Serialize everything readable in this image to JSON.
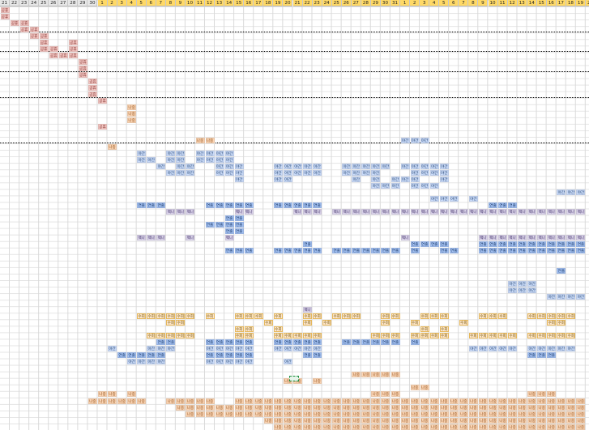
{
  "sheet": {
    "header_days": [
      {
        "label": "21",
        "style": "gray"
      },
      {
        "label": "22",
        "style": "gray"
      },
      {
        "label": "23",
        "style": "gray"
      },
      {
        "label": "24",
        "style": "gray"
      },
      {
        "label": "25",
        "style": "gray"
      },
      {
        "label": "26",
        "style": "gray"
      },
      {
        "label": "27",
        "style": "gray"
      },
      {
        "label": "28",
        "style": "gray"
      },
      {
        "label": "29",
        "style": "gray"
      },
      {
        "label": "30",
        "style": "gray"
      },
      {
        "label": "1",
        "style": "yellow"
      },
      {
        "label": "2",
        "style": "yellow"
      },
      {
        "label": "3",
        "style": "yellow"
      },
      {
        "label": "4",
        "style": "yellow"
      },
      {
        "label": "5",
        "style": "yellow"
      },
      {
        "label": "6",
        "style": "yellow"
      },
      {
        "label": "7",
        "style": "yellow"
      },
      {
        "label": "8",
        "style": "yellow"
      },
      {
        "label": "9",
        "style": "yellow"
      },
      {
        "label": "10",
        "style": "yellow"
      },
      {
        "label": "11",
        "style": "yellow"
      },
      {
        "label": "12",
        "style": "yellow"
      },
      {
        "label": "13",
        "style": "yellow"
      },
      {
        "label": "14",
        "style": "yellow"
      },
      {
        "label": "15",
        "style": "yellow"
      },
      {
        "label": "16",
        "style": "yellow"
      },
      {
        "label": "17",
        "style": "yellow"
      },
      {
        "label": "18",
        "style": "yellow"
      },
      {
        "label": "19",
        "style": "yellow"
      },
      {
        "label": "20",
        "style": "yellow"
      },
      {
        "label": "21",
        "style": "yellow"
      },
      {
        "label": "22",
        "style": "yellow"
      },
      {
        "label": "23",
        "style": "yellow"
      },
      {
        "label": "24",
        "style": "yellow"
      },
      {
        "label": "25",
        "style": "yellow"
      },
      {
        "label": "26",
        "style": "yellow"
      },
      {
        "label": "27",
        "style": "yellow"
      },
      {
        "label": "28",
        "style": "yellow"
      },
      {
        "label": "29",
        "style": "yellow"
      },
      {
        "label": "30",
        "style": "yellow"
      },
      {
        "label": "31",
        "style": "yellow"
      },
      {
        "label": "1",
        "style": "yellow"
      },
      {
        "label": "2",
        "style": "yellow"
      },
      {
        "label": "3",
        "style": "yellow"
      },
      {
        "label": "4",
        "style": "yellow"
      },
      {
        "label": "5",
        "style": "yellow"
      },
      {
        "label": "6",
        "style": "yellow"
      },
      {
        "label": "7",
        "style": "yellow"
      },
      {
        "label": "8",
        "style": "yellow"
      },
      {
        "label": "9",
        "style": "yellow"
      },
      {
        "label": "10",
        "style": "yellow"
      },
      {
        "label": "11",
        "style": "yellow"
      },
      {
        "label": "12",
        "style": "yellow"
      },
      {
        "label": "13",
        "style": "yellow"
      },
      {
        "label": "14",
        "style": "yellow"
      },
      {
        "label": "15",
        "style": "yellow"
      },
      {
        "label": "16",
        "style": "yellow"
      },
      {
        "label": "17",
        "style": "yellow"
      },
      {
        "label": "18",
        "style": "yellow"
      },
      {
        "label": "19",
        "style": "yellow"
      },
      {
        "label": "20",
        "style": "yellow"
      }
    ],
    "section_dividers": [
      4,
      7,
      10,
      14,
      21
    ],
    "colors": {
      "header_gray": "#e7e7e7",
      "header_yellow": "#ffd966",
      "pink": "#f4c7c3",
      "orange": "#fbd5b5",
      "blue": "#c9daf8",
      "blue_dark": "#a4c2f4",
      "lavender": "#d9d2e9",
      "gold": "#fce5cd",
      "selection": "#1e8e3e"
    },
    "labels": {
      "pink": "공휴",
      "orange": "나중",
      "blue": "야간",
      "blue_dark": "연출",
      "lavender": "팩나",
      "gold": "수회"
    },
    "runs": [
      {
        "row": 1,
        "cols": [
          0
        ],
        "color": "pink"
      },
      {
        "row": 2,
        "cols": [
          0
        ],
        "color": "pink"
      },
      {
        "row": 3,
        "cols": [
          1,
          2
        ],
        "color": "pink"
      },
      {
        "row": 4,
        "cols": [
          2,
          3
        ],
        "color": "pink"
      },
      {
        "row": 5,
        "cols": [
          3,
          4
        ],
        "color": "pink"
      },
      {
        "row": 6,
        "cols": [
          4,
          7
        ],
        "color": "pink"
      },
      {
        "row": 7,
        "cols": [
          4,
          5,
          7
        ],
        "color": "pink"
      },
      {
        "row": 8,
        "cols": [
          5,
          6,
          7
        ],
        "color": "pink"
      },
      {
        "row": 9,
        "cols": [
          8
        ],
        "color": "pink"
      },
      {
        "row": 10,
        "cols": [
          8
        ],
        "color": "pink"
      },
      {
        "row": 11,
        "cols": [
          8
        ],
        "color": "pink"
      },
      {
        "row": 12,
        "cols": [
          9
        ],
        "color": "pink"
      },
      {
        "row": 13,
        "cols": [
          9
        ],
        "color": "pink"
      },
      {
        "row": 14,
        "cols": [
          9
        ],
        "color": "pink"
      },
      {
        "row": 15,
        "cols": [
          10
        ],
        "color": "pink"
      },
      {
        "row": 16,
        "cols": [
          13
        ],
        "color": "orange"
      },
      {
        "row": 17,
        "cols": [
          13
        ],
        "color": "orange"
      },
      {
        "row": 18,
        "cols": [
          13
        ],
        "color": "orange"
      },
      {
        "row": 19,
        "cols": [
          10
        ],
        "color": "pink"
      },
      {
        "row": 21,
        "cols": [
          20,
          21
        ],
        "color": "orange"
      },
      {
        "row": 21,
        "cols": [
          41,
          42,
          43
        ],
        "color": "blue"
      },
      {
        "row": 22,
        "cols": [
          11
        ],
        "color": "orange"
      },
      {
        "row": 23,
        "cols": [
          14,
          17,
          18,
          20,
          21,
          22,
          23
        ],
        "color": "blue"
      },
      {
        "row": 24,
        "cols": [
          14,
          15,
          17,
          18,
          20,
          21,
          22,
          23
        ],
        "color": "blue"
      },
      {
        "row": 25,
        "cols": [
          16,
          18,
          19,
          22,
          23,
          24,
          28,
          29,
          30,
          31,
          32,
          35,
          36,
          37,
          38,
          39,
          41,
          42,
          43,
          44,
          45
        ],
        "color": "blue"
      },
      {
        "row": 26,
        "cols": [
          17,
          18,
          19,
          22,
          23,
          24,
          28,
          29,
          30,
          31,
          32,
          35,
          36,
          37,
          38,
          42,
          43,
          44,
          45
        ],
        "color": "blue"
      },
      {
        "row": 27,
        "cols": [
          24,
          28,
          29,
          36,
          38,
          40,
          41,
          42,
          45
        ],
        "color": "blue"
      },
      {
        "row": 28,
        "cols": [
          38,
          39,
          40,
          42,
          43,
          44
        ],
        "color": "blue"
      },
      {
        "row": 29,
        "cols": [
          57,
          58,
          59
        ],
        "color": "blue"
      },
      {
        "row": 30,
        "cols": [
          44,
          45,
          46,
          48
        ],
        "color": "blue"
      },
      {
        "row": 31,
        "cols": [
          14,
          15,
          16,
          21,
          22,
          23,
          24,
          25,
          28,
          29,
          30,
          31,
          32,
          50,
          51,
          52
        ],
        "color": "blue_dark"
      },
      {
        "row": 32,
        "cols": [
          17,
          18,
          19,
          24,
          25,
          30,
          31,
          32,
          34,
          35,
          36,
          37,
          38,
          39,
          40,
          41,
          42,
          43,
          44,
          45,
          46,
          47,
          48,
          49,
          50,
          51,
          52,
          53,
          54,
          55,
          56,
          57,
          58,
          59
        ],
        "color": "lavender"
      },
      {
        "row": 33,
        "cols": [
          23,
          24
        ],
        "color": "blue_dark"
      },
      {
        "row": 34,
        "cols": [
          21,
          22,
          23,
          24
        ],
        "color": "blue_dark"
      },
      {
        "row": 35,
        "cols": [
          23,
          24
        ],
        "color": "blue_dark"
      },
      {
        "row": 36,
        "cols": [
          14,
          15,
          16,
          19,
          23,
          41,
          49,
          50,
          51,
          52,
          53,
          54,
          55,
          56,
          57,
          58,
          59
        ],
        "color": "lavender"
      },
      {
        "row": 37,
        "cols": [
          31,
          42,
          43,
          44,
          45,
          49,
          50,
          51,
          52,
          53,
          54,
          55,
          56,
          57,
          58,
          59
        ],
        "color": "blue_dark"
      },
      {
        "row": 38,
        "cols": [
          23,
          24,
          25,
          28,
          29,
          30,
          31,
          32,
          34,
          35,
          36,
          37,
          38,
          39,
          40,
          42,
          45,
          46,
          49,
          50,
          51,
          52,
          53,
          54,
          55,
          56,
          57,
          58,
          59
        ],
        "color": "blue_dark"
      },
      {
        "row": 41,
        "cols": [
          57
        ],
        "color": "blue_dark"
      },
      {
        "row": 43,
        "cols": [
          52,
          53,
          54
        ],
        "color": "blue"
      },
      {
        "row": 44,
        "cols": [
          52,
          53,
          54
        ],
        "color": "blue"
      },
      {
        "row": 45,
        "cols": [
          56,
          57,
          58,
          59
        ],
        "color": "blue"
      },
      {
        "row": 47,
        "cols": [
          31
        ],
        "color": "lavender"
      },
      {
        "row": 48,
        "cols": [
          14,
          15,
          16,
          17,
          18,
          19,
          21,
          24,
          25,
          26,
          28,
          31,
          32,
          34,
          35,
          36,
          39,
          40,
          43,
          44,
          45,
          49,
          50,
          51,
          54,
          55,
          56,
          57,
          58
        ],
        "color": "gold"
      },
      {
        "row": 49,
        "cols": [
          17,
          18,
          27,
          31,
          33,
          39,
          42,
          47,
          56,
          57
        ],
        "color": "gold"
      },
      {
        "row": 50,
        "cols": [
          24,
          25,
          28,
          43,
          45
        ],
        "color": "gold"
      },
      {
        "row": 51,
        "cols": [
          15,
          16,
          17,
          18,
          19,
          24,
          25,
          28,
          29,
          30,
          31,
          32,
          38,
          39,
          40,
          42,
          43,
          44,
          45,
          48,
          49,
          50,
          51,
          52,
          54,
          55,
          56,
          57,
          58
        ],
        "color": "gold"
      },
      {
        "row": 52,
        "cols": [
          16,
          17,
          21,
          22,
          23,
          24,
          25,
          28,
          29,
          30,
          31,
          32,
          35,
          36,
          37,
          38,
          39,
          40,
          42
        ],
        "color": "blue_dark"
      },
      {
        "row": 53,
        "cols": [
          11,
          15,
          16,
          17,
          21,
          22,
          23,
          24,
          25,
          28,
          29,
          30,
          31,
          32,
          48,
          49,
          50,
          51,
          52,
          54,
          55,
          56,
          57,
          58
        ],
        "color": "blue"
      },
      {
        "row": 54,
        "cols": [
          12,
          13,
          14,
          15,
          16,
          21,
          22,
          23,
          24,
          25,
          31,
          32,
          54,
          55,
          56
        ],
        "color": "blue_dark"
      },
      {
        "row": 55,
        "cols": [
          13,
          14,
          15,
          16,
          21,
          22,
          23,
          24,
          25,
          29
        ],
        "color": "blue"
      },
      {
        "row": 57,
        "cols": [
          36,
          37,
          38,
          39,
          40
        ],
        "color": "orange"
      },
      {
        "row": 58,
        "cols": [
          29,
          30,
          32
        ],
        "color": "orange"
      },
      {
        "row": 59,
        "cols": [
          42,
          43
        ],
        "color": "orange"
      },
      {
        "row": 60,
        "cols": [
          10,
          11,
          13,
          38,
          39,
          40,
          54,
          55,
          56
        ],
        "color": "orange"
      },
      {
        "row": 61,
        "cols": [
          9,
          10,
          11,
          12,
          13,
          14,
          17,
          18,
          19,
          20,
          21,
          24,
          25,
          26,
          27,
          28,
          29,
          30,
          31,
          32,
          33,
          34,
          35,
          36,
          37,
          38,
          39,
          40,
          41,
          42,
          43,
          44,
          45,
          46,
          47,
          48,
          49,
          50,
          51,
          52,
          53,
          54,
          55,
          56,
          57,
          58,
          59
        ],
        "color": "orange"
      },
      {
        "row": 62,
        "cols": [
          18,
          19,
          20,
          21,
          22,
          23,
          24,
          25,
          26,
          27,
          28,
          29,
          30,
          31,
          32,
          33,
          34,
          35,
          36,
          37,
          38,
          39,
          40,
          41,
          42,
          43,
          44,
          45,
          46,
          47,
          48,
          49,
          50,
          51,
          52,
          53,
          54,
          55,
          56,
          57,
          58,
          59
        ],
        "color": "orange"
      },
      {
        "row": 63,
        "cols": [
          19,
          20,
          21,
          22,
          23,
          24,
          25,
          26,
          27,
          28,
          29,
          30,
          31,
          32,
          33,
          34,
          35,
          36,
          37,
          38,
          39,
          40,
          41,
          42,
          43,
          44,
          45,
          46,
          47,
          48,
          49,
          50,
          51,
          52,
          53,
          54,
          55,
          56,
          57,
          58,
          59
        ],
        "color": "orange"
      },
      {
        "row": 64,
        "cols": [
          27,
          28,
          29,
          30,
          31,
          32,
          33,
          34,
          35,
          36,
          37,
          38,
          39,
          40,
          41,
          42,
          43,
          44,
          45,
          46,
          47,
          48,
          49,
          50,
          51,
          52,
          53,
          54,
          55,
          56,
          57,
          58,
          59
        ],
        "color": "orange"
      },
      {
        "row": 65,
        "cols": [
          28,
          29,
          30,
          31,
          32,
          33,
          34,
          35,
          36,
          37,
          38,
          39,
          40,
          41,
          42,
          43,
          44,
          45,
          46,
          47,
          48,
          49,
          50,
          51,
          52,
          53,
          54,
          55,
          56,
          57,
          58,
          59
        ],
        "color": "orange"
      }
    ]
  }
}
